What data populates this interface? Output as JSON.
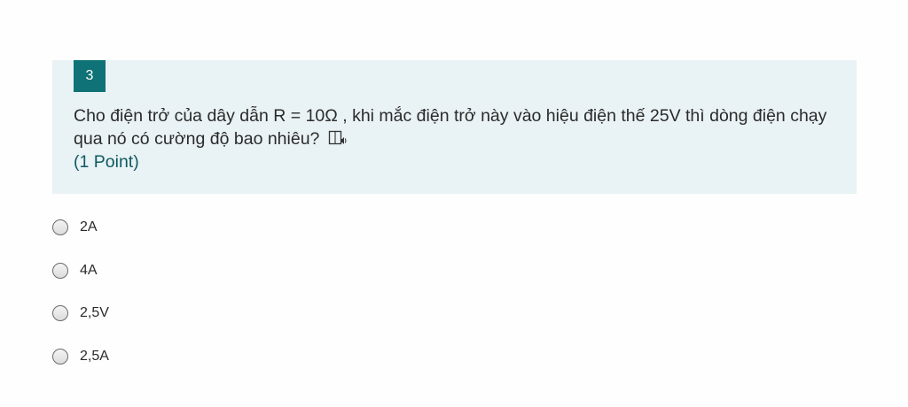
{
  "question": {
    "number": "3",
    "text": "Cho điện trở của dây dẫn R = 10Ω , khi mắc điện trở này vào hiệu điện thế 25V thì dòng điện chạy qua nó có cường độ bao nhiêu?",
    "points": "(1 Point)",
    "reader_icon": "immersive-reader-icon"
  },
  "options": [
    {
      "label": "2A"
    },
    {
      "label": "4A"
    },
    {
      "label": "2,5V"
    },
    {
      "label": "2,5A"
    }
  ],
  "colors": {
    "accent": "#0f7276",
    "card_background": "#e9f2f4",
    "points_text": "#0e5a63"
  }
}
